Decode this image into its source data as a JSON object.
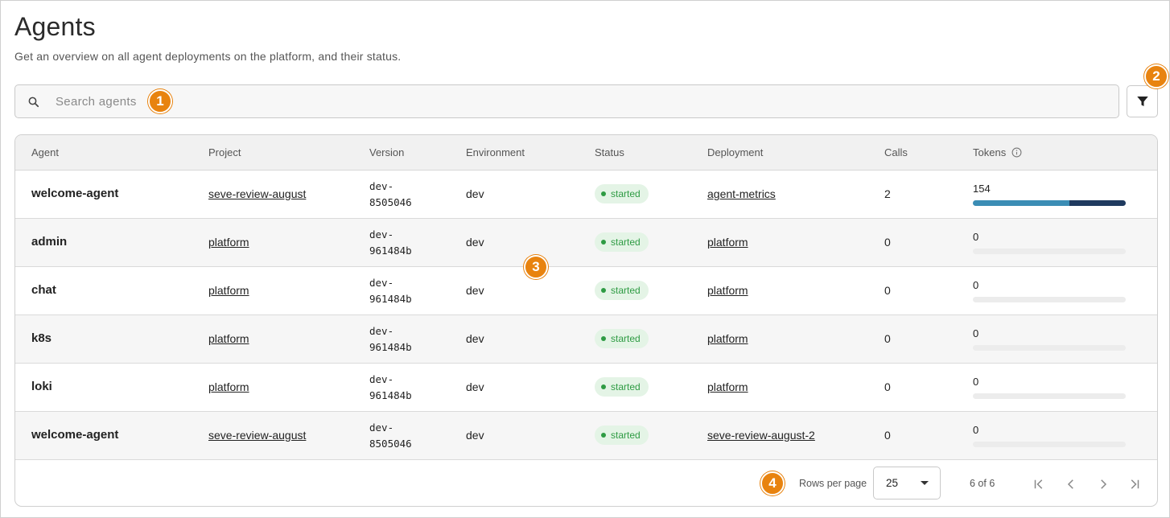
{
  "page": {
    "title": "Agents",
    "subtitle": "Get an overview on all agent deployments on the platform, and their status."
  },
  "search": {
    "placeholder": "Search agents",
    "icon": "search-icon"
  },
  "filter": {
    "icon": "filter-icon"
  },
  "badges": [
    "1",
    "2",
    "3",
    "4"
  ],
  "table": {
    "columns": [
      "Agent",
      "Project",
      "Version",
      "Environment",
      "Status",
      "Deployment",
      "Calls",
      "Tokens"
    ],
    "rows": [
      {
        "agent": "welcome-agent",
        "project": "seve-review-august",
        "version_1": "dev-",
        "version_2": "8505046",
        "environment": "dev",
        "status": "started",
        "deployment": "agent-metrics",
        "calls": "2",
        "tokens": "154",
        "token_bar": {
          "segment_1": 0.63,
          "segment_2": 0.37
        }
      },
      {
        "agent": "admin",
        "project": "platform",
        "version_1": "dev-",
        "version_2": "961484b",
        "environment": "dev",
        "status": "started",
        "deployment": "platform",
        "calls": "0",
        "tokens": "0",
        "token_bar": {
          "segment_1": 0,
          "segment_2": 0
        }
      },
      {
        "agent": "chat",
        "project": "platform",
        "version_1": "dev-",
        "version_2": "961484b",
        "environment": "dev",
        "status": "started",
        "deployment": "platform",
        "calls": "0",
        "tokens": "0",
        "token_bar": {
          "segment_1": 0,
          "segment_2": 0
        }
      },
      {
        "agent": "k8s",
        "project": "platform",
        "version_1": "dev-",
        "version_2": "961484b",
        "environment": "dev",
        "status": "started",
        "deployment": "platform",
        "calls": "0",
        "tokens": "0",
        "token_bar": {
          "segment_1": 0,
          "segment_2": 0
        }
      },
      {
        "agent": "loki",
        "project": "platform",
        "version_1": "dev-",
        "version_2": "961484b",
        "environment": "dev",
        "status": "started",
        "deployment": "platform",
        "calls": "0",
        "tokens": "0",
        "token_bar": {
          "segment_1": 0,
          "segment_2": 0
        }
      },
      {
        "agent": "welcome-agent",
        "project": "seve-review-august",
        "version_1": "dev-",
        "version_2": "8505046",
        "environment": "dev",
        "status": "started",
        "deployment": "seve-review-august-2",
        "calls": "0",
        "tokens": "0",
        "token_bar": {
          "segment_1": 0,
          "segment_2": 0
        }
      }
    ]
  },
  "pagination": {
    "rows_per_page_label": "Rows per page",
    "rows_per_page_value": "25",
    "page_info": "6 of 6"
  },
  "colors": {
    "badge": "#e8830f",
    "status_bg": "#e4f4e6",
    "status_text": "#2e9b43",
    "bar_primary": "#3b8db5",
    "bar_secondary": "#1f3a5f"
  }
}
